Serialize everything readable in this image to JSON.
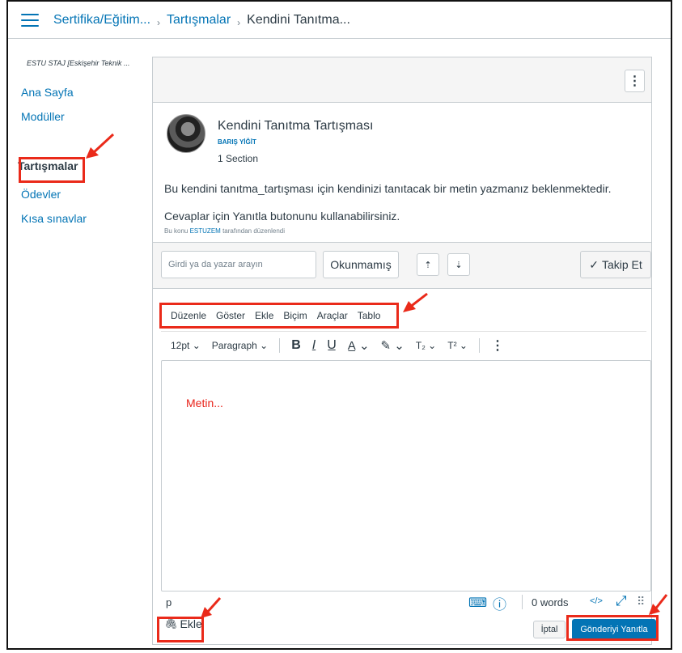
{
  "breadcrumb": {
    "items": [
      "Sertifika/Eğitim...",
      "Tartışmalar"
    ],
    "current": "Kendini Tanıtma..."
  },
  "sidebar": {
    "course_name": "ESTU STAJ [Eskişehir Teknik ...",
    "items": [
      {
        "label": "Ana Sayfa"
      },
      {
        "label": "Modüller"
      },
      {
        "label": "Tartışmalar",
        "active": true
      },
      {
        "label": "Ödevler"
      },
      {
        "label": "Kısa sınavlar"
      }
    ]
  },
  "topic": {
    "title": "Kendini Tanıtma Tartışması",
    "author": "BARIŞ YİĞİT",
    "section": "1 Section",
    "paragraph1": "Bu kendini tanıtma_tartışması için kendinizi tanıtacak bir metin yazmanız beklenmektedir.",
    "paragraph2": "Cevaplar için Yanıtla butonunu kullanabilirsiniz.",
    "edited_prefix": "Bu konu",
    "edited_by": "ESTUZEM",
    "edited_suffix": "tarafından düzenlendi"
  },
  "filters": {
    "search_placeholder": "Girdi ya da yazar arayın",
    "unread_label": "Okunmamış",
    "follow_label": "Takip Et"
  },
  "editor": {
    "menu": [
      "Düzenle",
      "Göster",
      "Ekle",
      "Biçim",
      "Araçlar",
      "Tablo"
    ],
    "font_size": "12pt",
    "block_format": "Paragraph",
    "content": "Metin...",
    "path": "p",
    "word_count": "0 words"
  },
  "actions": {
    "attach_label": "Ekle",
    "cancel_label": "İptal",
    "reply_label": "Gönderiyi Yanıtla"
  },
  "colors": {
    "link": "#0374b5",
    "annotation": "#ea2a1a",
    "primary_button": "#0374b5"
  }
}
